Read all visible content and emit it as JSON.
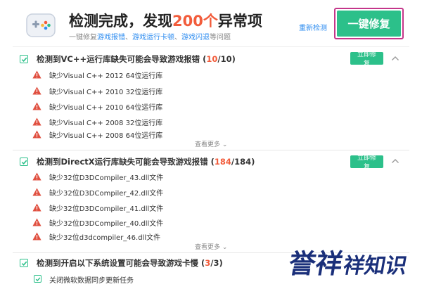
{
  "header": {
    "title_prefix": "检测完成，发现",
    "title_count": "200个",
    "title_suffix": "异常项",
    "subtitle_prefix": "一键修复",
    "subtitle_link1": "游戏报错",
    "subtitle_sep1": "、",
    "subtitle_link2": "游戏运行卡顿",
    "subtitle_sep2": "、",
    "subtitle_link3": "游戏闪退",
    "subtitle_suffix": "等问题",
    "rescan_label": "重新检测",
    "fix_all_label": "一键修复"
  },
  "sections": [
    {
      "title_prefix": "检测到VC++运行库缺失可能会导致游戏报错 (",
      "found": "10",
      "title_suffix": "/10)",
      "fix_label": "立即修复",
      "items": [
        "缺少Visual C++ 2012 64位运行库",
        "缺少Visual C++ 2010 32位运行库",
        "缺少Visual C++ 2010 64位运行库",
        "缺少Visual C++ 2008 32位运行库",
        "缺少Visual C++ 2008 64位运行库"
      ],
      "see_more": "查看更多"
    },
    {
      "title_prefix": "检测到DirectX运行库缺失可能会导致游戏报错 (",
      "found": "184",
      "title_suffix": "/184)",
      "fix_label": "立即修复",
      "items": [
        "缺少32位D3DCompiler_43.dll文件",
        "缺少32位D3DCompiler_42.dll文件",
        "缺少32位D3DCompiler_41.dll文件",
        "缺少32位D3DCompiler_40.dll文件",
        "缺少32位d3dcompiler_46.dll文件"
      ],
      "see_more": "查看更多"
    },
    {
      "title_prefix": "检测到开启以下系统设置可能会导致游戏卡慢 (",
      "found": "3",
      "title_suffix": "/3)",
      "items": [
        "关闭微软数据同步更新任务"
      ]
    }
  ],
  "watermark": {
    "text": "誉祥祥知识"
  },
  "colors": {
    "accent_green": "#2cc08a",
    "error_red": "#f25c3b",
    "link_blue": "#2d8cf0",
    "highlight_frame": "#c4368a"
  }
}
